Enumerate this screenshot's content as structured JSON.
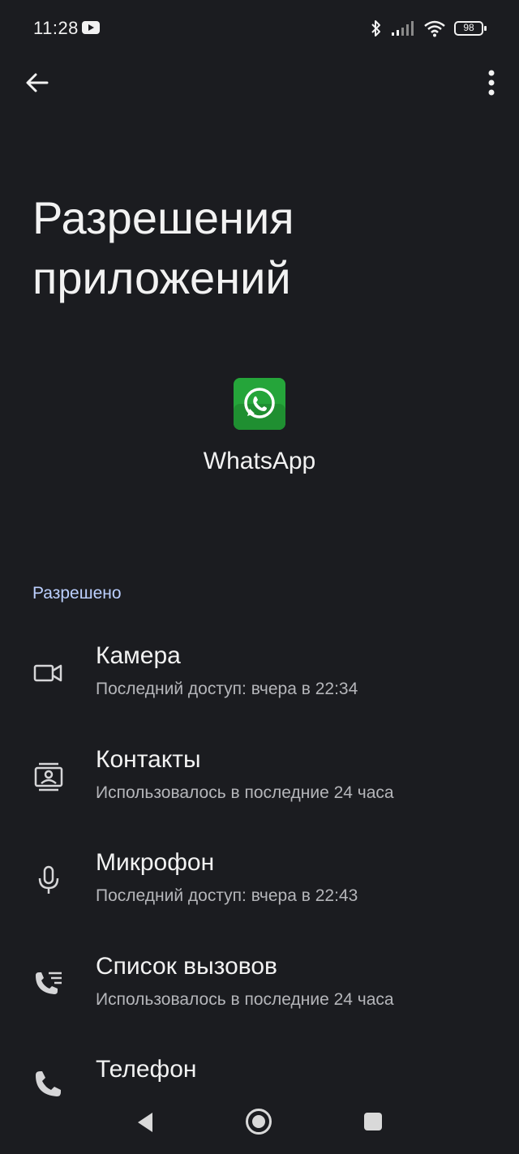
{
  "status_bar": {
    "time": "11:28",
    "battery": "98"
  },
  "page": {
    "title": "Разрешения приложений"
  },
  "app": {
    "name": "WhatsApp"
  },
  "section": {
    "label": "Разрешено"
  },
  "permissions": [
    {
      "icon": "camera-icon",
      "title": "Камера",
      "subtitle": "Последний доступ: вчера в 22:34"
    },
    {
      "icon": "contacts-icon",
      "title": "Контакты",
      "subtitle": "Использовалось в последние 24 часа"
    },
    {
      "icon": "microphone-icon",
      "title": "Микрофон",
      "subtitle": "Последний доступ: вчера в 22:43"
    },
    {
      "icon": "call-log-icon",
      "title": "Список вызовов",
      "subtitle": "Использовалось в последние 24 часа"
    },
    {
      "icon": "phone-icon",
      "title": "Телефон",
      "subtitle": ""
    }
  ],
  "colors": {
    "background": "#1b1c20",
    "accent_label": "#bcd0ff",
    "whatsapp_green": "#25a53a"
  }
}
